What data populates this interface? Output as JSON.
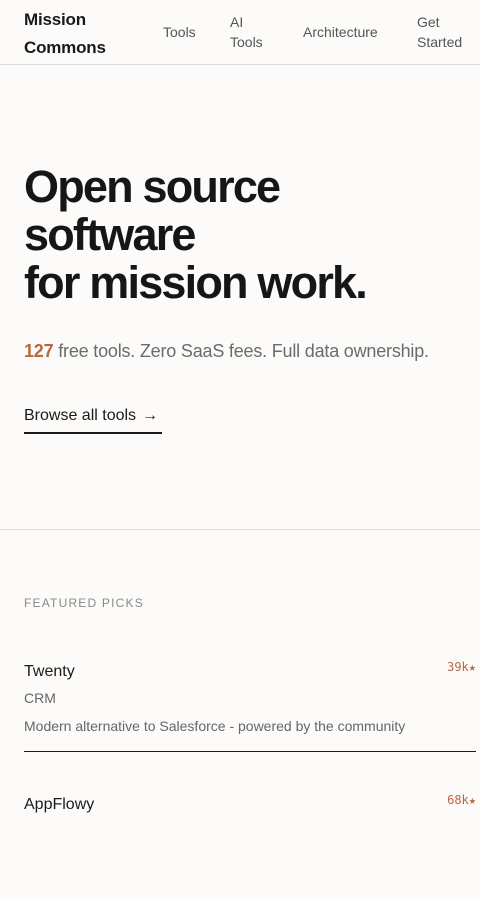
{
  "nav": {
    "brand": "Mission Commons",
    "links": [
      "Tools",
      "AI Tools",
      "Architecture",
      "Get Started"
    ]
  },
  "hero": {
    "title_lines": [
      "Open source",
      "software",
      "for mission work."
    ],
    "count": "127",
    "tagline": "free tools. Zero SaaS fees. Full data ownership.",
    "cta_label": "Browse all tools",
    "cta_icon": "arrow-right-icon"
  },
  "featured": {
    "label": "FEATURED PICKS",
    "items": [
      {
        "name": "Twenty",
        "category": "CRM",
        "description": "Modern alternative to Salesforce - powered by the community",
        "stars": "39k★"
      },
      {
        "name": "AppFlowy",
        "stars": "68k★"
      }
    ]
  },
  "colors": {
    "accent": "#b8683f",
    "background": "#fcfbf9",
    "text": "#1a1a1a"
  }
}
